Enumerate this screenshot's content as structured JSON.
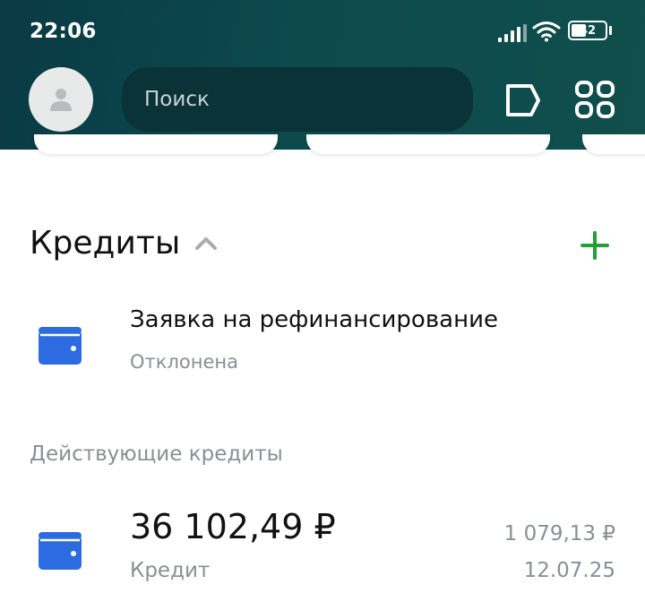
{
  "status_bar": {
    "time": "22:06",
    "battery": "42"
  },
  "header": {
    "search_placeholder": "Поиск"
  },
  "credits": {
    "title": "Кредиты",
    "application": {
      "title": "Заявка на рефинансирование",
      "status": "Отклонена"
    },
    "active_group_label": "Действующие кредиты",
    "loan": {
      "amount": "36 102,49 ₽",
      "label": "Кредит",
      "payment": "1 079,13 ₽",
      "date": "12.07.25"
    }
  },
  "colors": {
    "header_bg": "#0c4a4e",
    "accent_green": "#21a038",
    "wallet_blue": "#2d6be0"
  },
  "icons": [
    "user-icon",
    "flag-icon",
    "grid-icon",
    "chevron-up-icon",
    "plus-icon",
    "wallet-icon"
  ]
}
